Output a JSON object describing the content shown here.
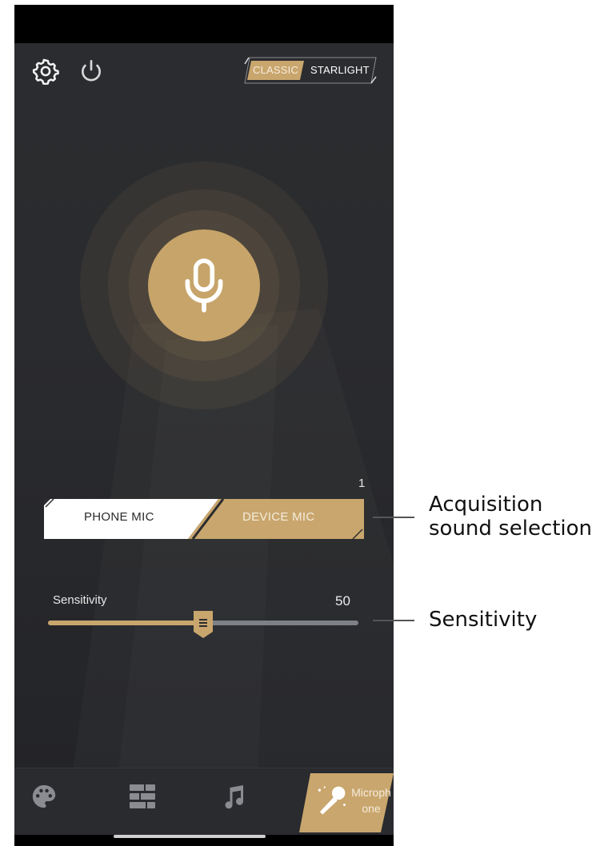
{
  "header": {
    "mode_toggle": {
      "options": [
        "CLASSIC",
        "STARLIGHT"
      ],
      "selected": "CLASSIC"
    }
  },
  "microphone": {
    "icon": "microphone-icon"
  },
  "channel_count": "1",
  "source_selector": {
    "options": [
      "PHONE MIC",
      "DEVICE MIC"
    ],
    "phone_label": "PHONE MIC",
    "device_label": "DEVICE MIC",
    "selected": "DEVICE MIC"
  },
  "sensitivity": {
    "label": "Sensitivity",
    "value": "50",
    "fraction": 0.5
  },
  "tab_bar": {
    "tabs": [
      {
        "icon": "palette-icon",
        "label": ""
      },
      {
        "icon": "segments-icon",
        "label": ""
      },
      {
        "icon": "music-note-icon",
        "label": ""
      },
      {
        "icon": "karaoke-mic-icon",
        "label": "Microphone",
        "active": true
      }
    ],
    "active_label": "Microphone"
  },
  "annotations": {
    "acquisition": "Acquisition sound selection",
    "sensitivity": "Sensitivity"
  },
  "colors": {
    "accent": "#c7a46a",
    "background": "#2b2c2f",
    "track": "#7d8087"
  }
}
